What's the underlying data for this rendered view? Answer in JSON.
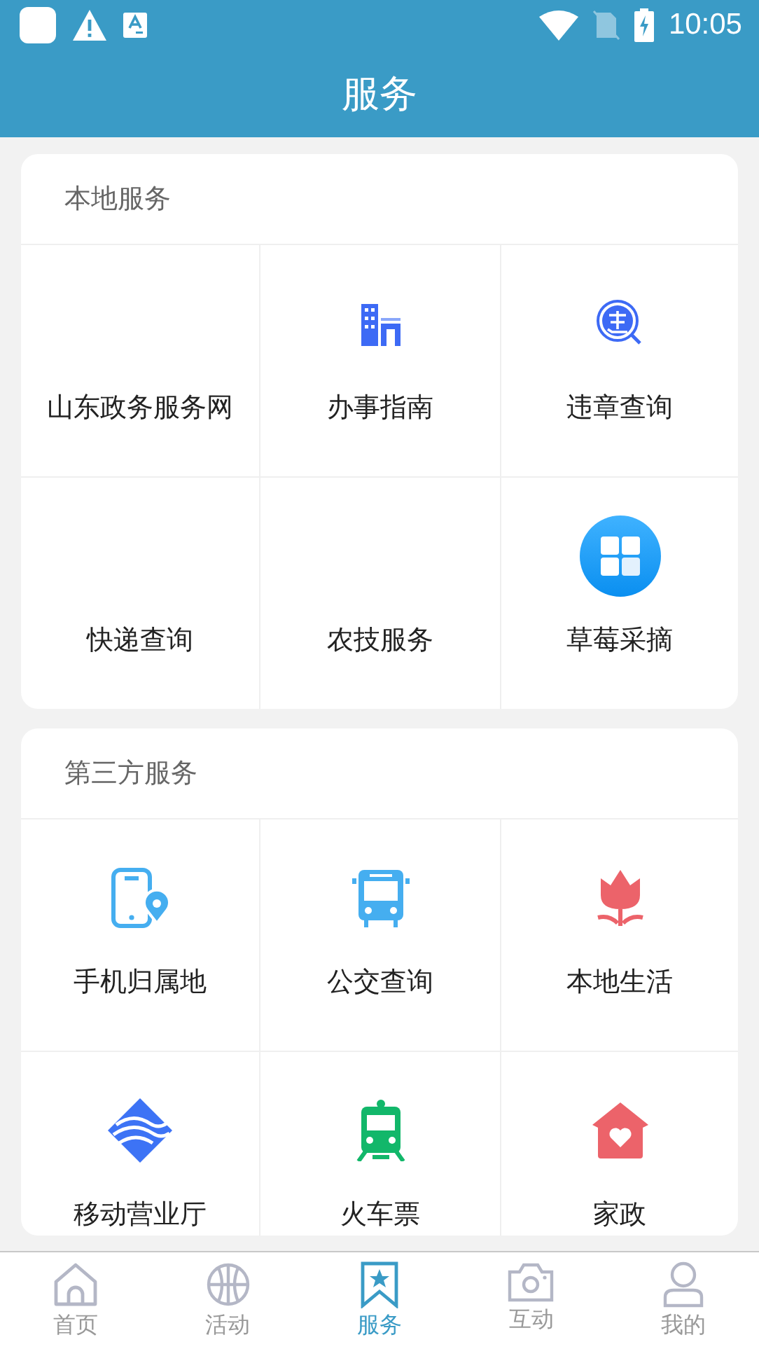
{
  "status_bar": {
    "time": "10:05"
  },
  "header": {
    "title": "服务"
  },
  "sections": [
    {
      "title": "本地服务",
      "items": [
        {
          "label": "山东政务服务网"
        },
        {
          "label": "办事指南"
        },
        {
          "label": "违章查询"
        },
        {
          "label": "快递查询"
        },
        {
          "label": "农技服务"
        },
        {
          "label": "草莓采摘"
        }
      ]
    },
    {
      "title": "第三方服务",
      "items": [
        {
          "label": "手机归属地"
        },
        {
          "label": "公交查询"
        },
        {
          "label": "本地生活"
        },
        {
          "label": "移动营业厅"
        },
        {
          "label": "火车票"
        },
        {
          "label": "家政"
        }
      ]
    }
  ],
  "tab_bar": [
    {
      "label": "首页",
      "selected": false
    },
    {
      "label": "活动",
      "selected": false
    },
    {
      "label": "服务",
      "selected": true
    },
    {
      "label": "互动",
      "selected": false
    },
    {
      "label": "我的",
      "selected": false
    }
  ]
}
